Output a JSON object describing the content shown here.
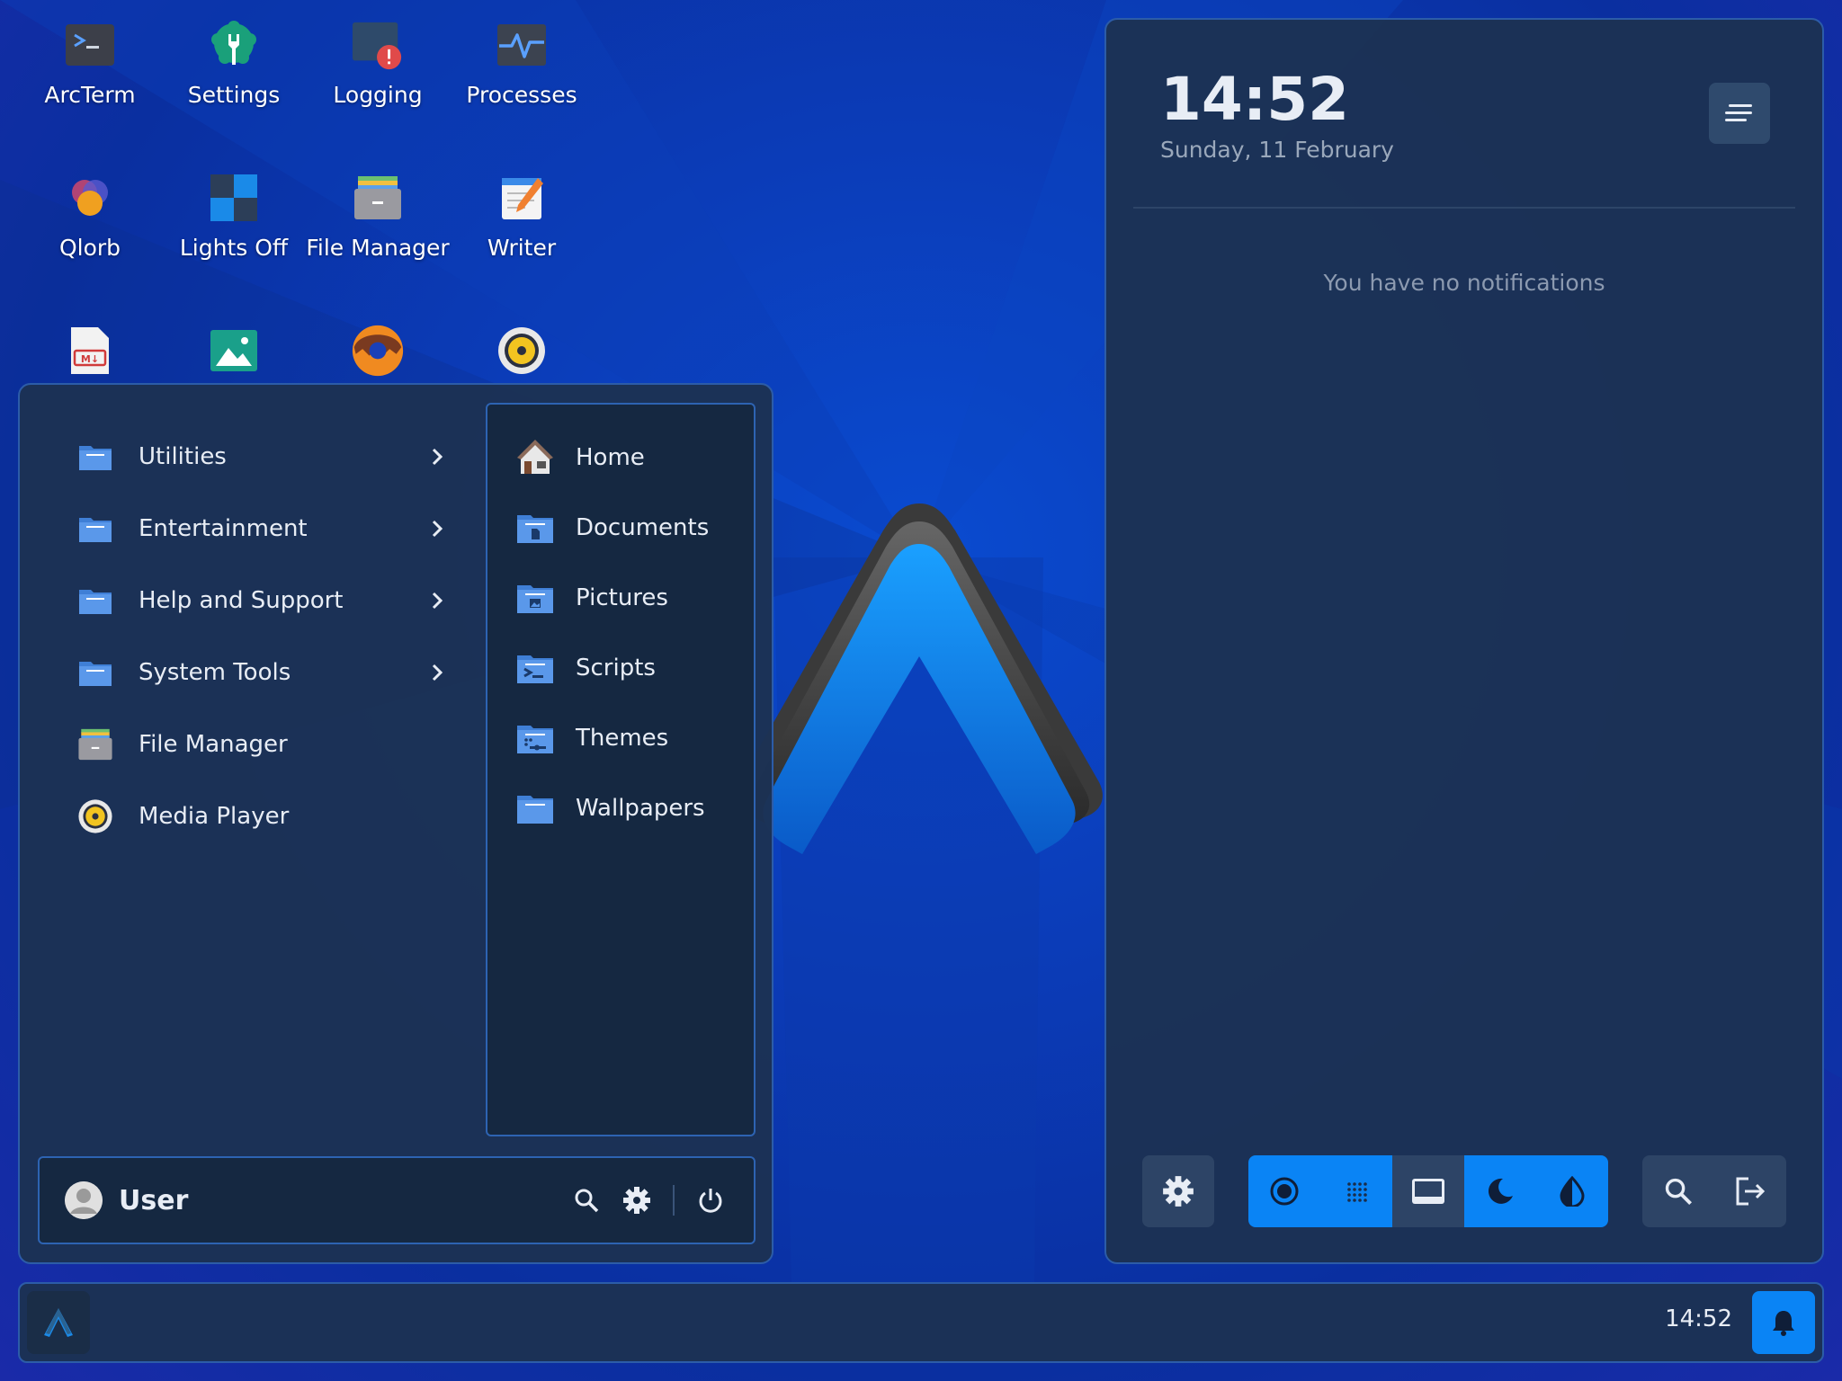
{
  "desktop": {
    "icons": [
      {
        "label": "ArcTerm",
        "icon": "terminal-icon"
      },
      {
        "label": "Settings",
        "icon": "settings-wrench-icon"
      },
      {
        "label": "Logging",
        "icon": "log-warning-icon"
      },
      {
        "label": "Processes",
        "icon": "activity-monitor-icon"
      },
      {
        "label": "Qlorb",
        "icon": "qlorb-orb-icon"
      },
      {
        "label": "Lights Off",
        "icon": "lights-off-icon"
      },
      {
        "label": "File Manager",
        "icon": "file-cabinet-icon"
      },
      {
        "label": "Writer",
        "icon": "writer-notepad-icon"
      },
      {
        "label": "",
        "icon": "markdown-file-icon"
      },
      {
        "label": "",
        "icon": "image-viewer-icon"
      },
      {
        "label": "",
        "icon": "donut-icon"
      },
      {
        "label": "",
        "icon": "speaker-icon"
      }
    ]
  },
  "start_menu": {
    "categories": [
      {
        "label": "Utilities",
        "icon": "folder-icon",
        "submenu": true
      },
      {
        "label": "Entertainment",
        "icon": "folder-icon",
        "submenu": true
      },
      {
        "label": "Help and Support",
        "icon": "folder-icon",
        "submenu": true
      },
      {
        "label": "System Tools",
        "icon": "folder-icon",
        "submenu": true
      },
      {
        "label": "File Manager",
        "icon": "file-cabinet-icon",
        "submenu": false
      },
      {
        "label": "Media Player",
        "icon": "speaker-icon",
        "submenu": false
      }
    ],
    "places": [
      {
        "label": "Home",
        "icon": "home-icon"
      },
      {
        "label": "Documents",
        "icon": "documents-folder-icon"
      },
      {
        "label": "Pictures",
        "icon": "pictures-folder-icon"
      },
      {
        "label": "Scripts",
        "icon": "scripts-folder-icon"
      },
      {
        "label": "Themes",
        "icon": "themes-folder-icon"
      },
      {
        "label": "Wallpapers",
        "icon": "wallpapers-folder-icon"
      }
    ],
    "user": {
      "name": "User"
    }
  },
  "notifications": {
    "time": "14:52",
    "date": "Sunday, 11 February",
    "empty_message": "You have no notifications"
  },
  "quick_settings": [
    {
      "icon": "gear-icon",
      "state": "neutral"
    },
    {
      "icon": "record-icon",
      "state": "on"
    },
    {
      "icon": "dots-grid-icon",
      "state": "on"
    },
    {
      "icon": "panel-icon",
      "state": "off"
    },
    {
      "icon": "moon-icon",
      "state": "on"
    },
    {
      "icon": "contrast-icon",
      "state": "on"
    },
    {
      "icon": "search-icon",
      "state": "neutral"
    },
    {
      "icon": "logout-icon",
      "state": "neutral"
    }
  ],
  "taskbar": {
    "clock": "14:52"
  },
  "colors": {
    "accent": "#0a84f5",
    "panel": "#1c3254",
    "folder": "#4f8fe0"
  }
}
